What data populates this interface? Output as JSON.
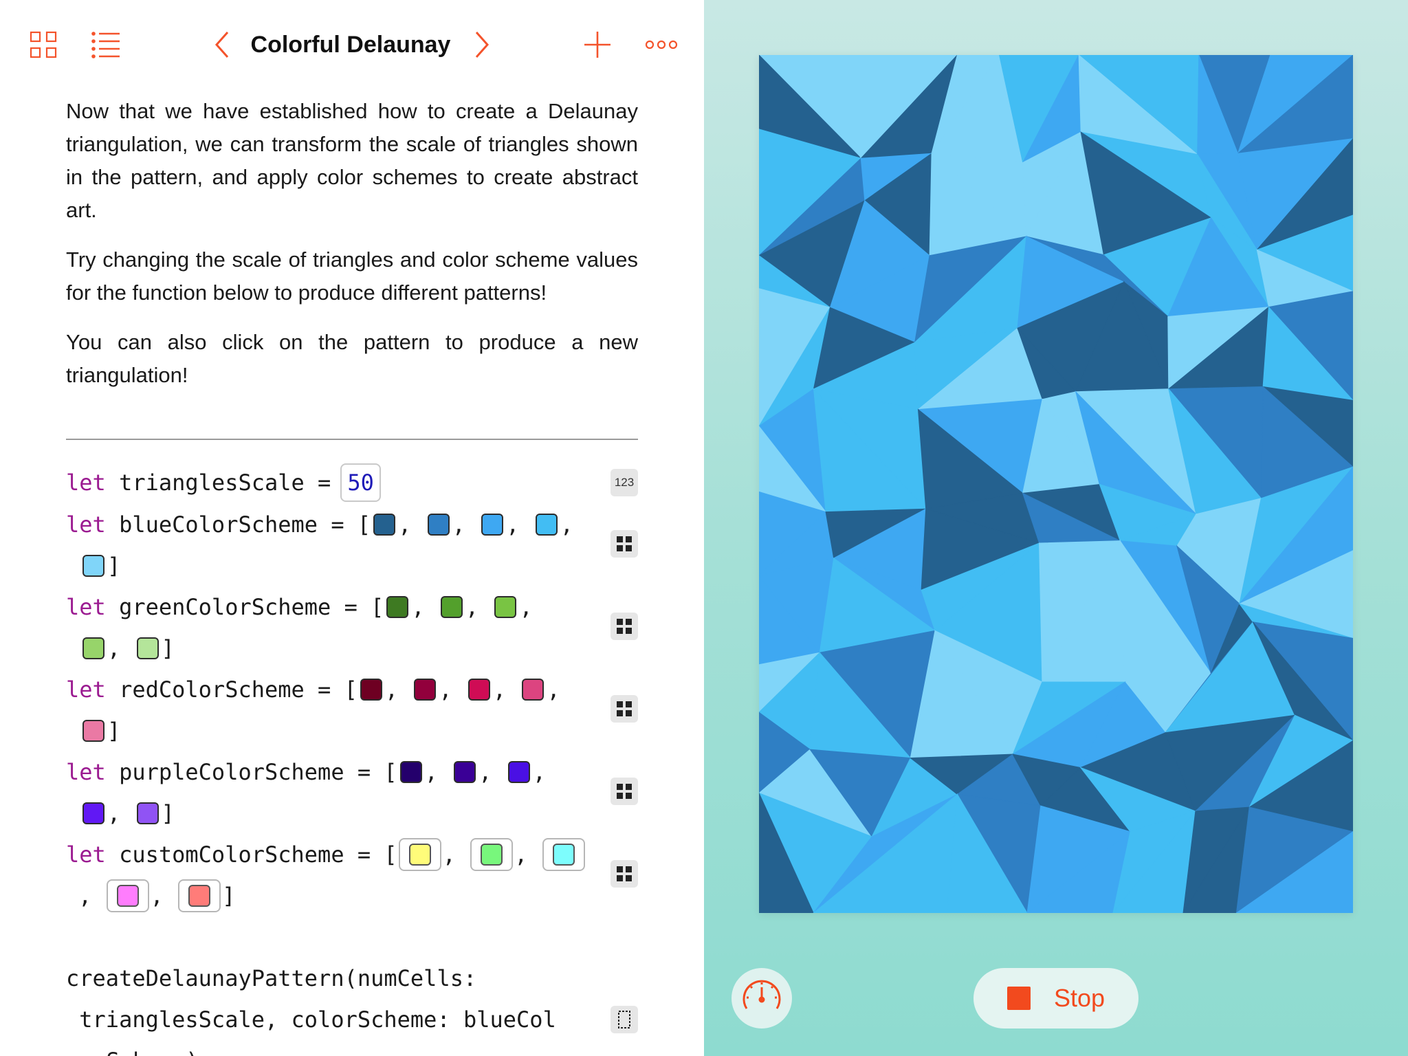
{
  "toolbar": {
    "title": "Colorful Delaunay",
    "icons": [
      "grid-icon",
      "list-icon",
      "chevron-left-icon",
      "chevron-right-icon",
      "plus-icon",
      "more-icon"
    ],
    "accent": "#f4532b"
  },
  "prose": {
    "p1": "Now that we have established how to create a Delaunay triangulation, we can transform the scale of triangles shown in the pattern, and apply color schemes to create abstract art.",
    "p2": "Try changing the scale of triangles and color scheme values for the function below to produce different patterns!",
    "p3": "You can also click on the pattern to produce a new triangulation!"
  },
  "code": {
    "kw": "let",
    "l1_name": "trianglesScale =",
    "l1_value": "50",
    "l1_badge": "123",
    "blue_name": "blueColorScheme = [",
    "green_name": "greenColorScheme = [",
    "red_name": "redColorScheme = [",
    "purple_name": "purpleColorScheme = [",
    "custom_name": "customColorScheme = [",
    "comma": ",",
    "close": "]",
    "call_1": "createDelaunayPattern(numCells:",
    "call_2": " trianglesScale, colorScheme: blueCol",
    "call_3": "orScheme)"
  },
  "colors": {
    "blue": [
      "#24618f",
      "#2f7fc4",
      "#3ea8f2",
      "#42bdf3",
      "#80d5f9"
    ],
    "green": [
      "#3e7a22",
      "#53a02c",
      "#79c443",
      "#97d46a",
      "#b4e59a"
    ],
    "red": [
      "#6e0022",
      "#92003c",
      "#cf0c55",
      "#dc4480",
      "#ea79a4"
    ],
    "purple": [
      "#24006c",
      "#3a0096",
      "#4a10e4",
      "#6118f4",
      "#9053f4"
    ],
    "custom": [
      "#fffc7a",
      "#78f77c",
      "#7dfdfd",
      "#ff7dfd",
      "#ff7c79"
    ]
  },
  "controls": {
    "stop_label": "Stop",
    "speed_icon": "speedometer-icon",
    "stop_color": "#f24a1e"
  }
}
